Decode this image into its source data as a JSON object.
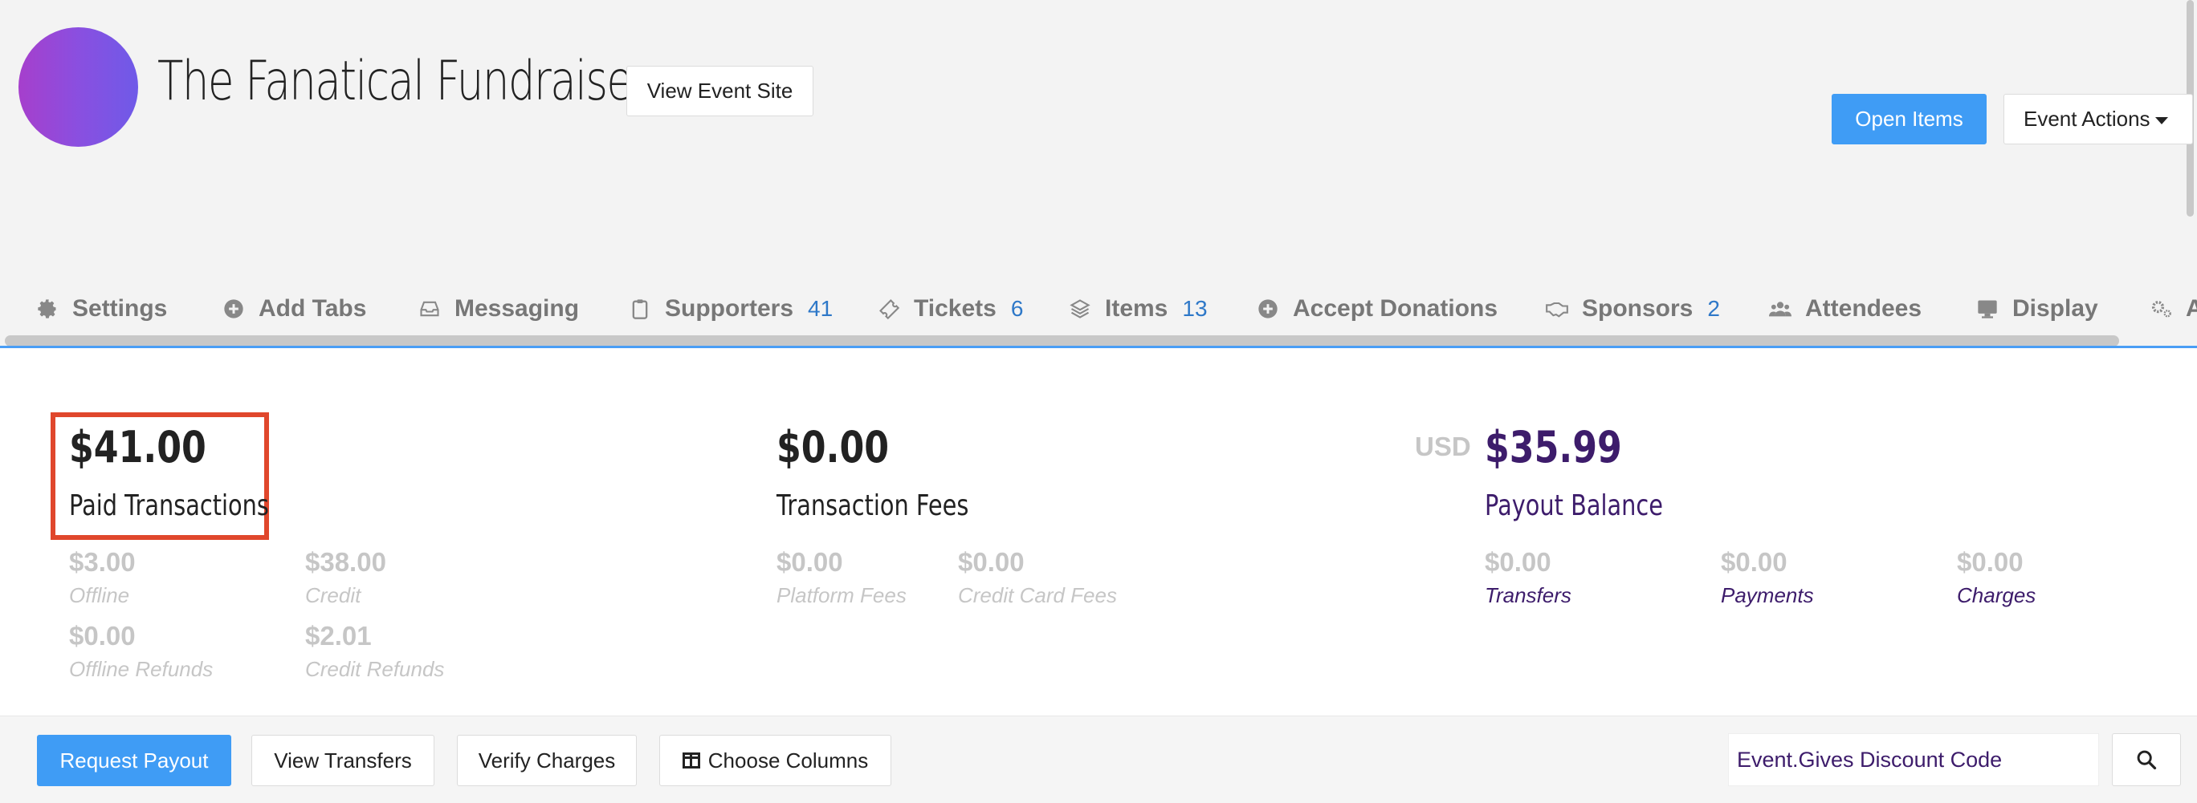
{
  "header": {
    "event_title": "The Fanatical Fundraiser",
    "view_site_label": "View Event Site",
    "open_items_label": "Open Items",
    "event_actions_label": "Event Actions"
  },
  "tabs": [
    {
      "label": "Settings",
      "icon": "gear-icon",
      "count": ""
    },
    {
      "label": "Add Tabs",
      "icon": "plus-circle-icon",
      "count": ""
    },
    {
      "label": "Messaging",
      "icon": "inbox-icon",
      "count": ""
    },
    {
      "label": "Supporters",
      "icon": "clipboard-icon",
      "count": "41"
    },
    {
      "label": "Tickets",
      "icon": "ticket-icon",
      "count": "6"
    },
    {
      "label": "Items",
      "icon": "layers-icon",
      "count": "13"
    },
    {
      "label": "Accept Donations",
      "icon": "plus-circle-icon",
      "count": ""
    },
    {
      "label": "Sponsors",
      "icon": "handshake-icon",
      "count": "2"
    },
    {
      "label": "Attendees",
      "icon": "users-icon",
      "count": ""
    },
    {
      "label": "Display",
      "icon": "monitor-icon",
      "count": ""
    },
    {
      "label": "A",
      "icon": "gears-icon",
      "count": ""
    }
  ],
  "stats": {
    "paid": {
      "value": "$41.00",
      "label": "Paid Transactions",
      "breakdown": [
        {
          "value": "$3.00",
          "label": "Offline"
        },
        {
          "value": "$38.00",
          "label": "Credit"
        },
        {
          "value": "$0.00",
          "label": "Offline Refunds"
        },
        {
          "value": "$2.01",
          "label": "Credit Refunds"
        }
      ]
    },
    "fees": {
      "value": "$0.00",
      "label": "Transaction Fees",
      "breakdown": [
        {
          "value": "$0.00",
          "label": "Platform Fees"
        },
        {
          "value": "$0.00",
          "label": "Credit Card Fees"
        }
      ]
    },
    "payout": {
      "currency": "USD",
      "value": "$35.99",
      "label": "Payout Balance",
      "breakdown": [
        {
          "value": "$0.00",
          "label": "Transfers"
        },
        {
          "value": "$0.00",
          "label": "Payments"
        },
        {
          "value": "$0.00",
          "label": "Charges"
        }
      ]
    }
  },
  "toolbar": {
    "request_payout": "Request Payout",
    "view_transfers": "View Transfers",
    "verify_charges": "Verify Charges",
    "choose_columns": "Choose Columns",
    "discount_code": "Event.Gives Discount Code"
  },
  "colors": {
    "accent": "#3f9cf5",
    "purple": "#3d1c6b",
    "highlight": "#e0472c",
    "count": "#2e78c8"
  }
}
